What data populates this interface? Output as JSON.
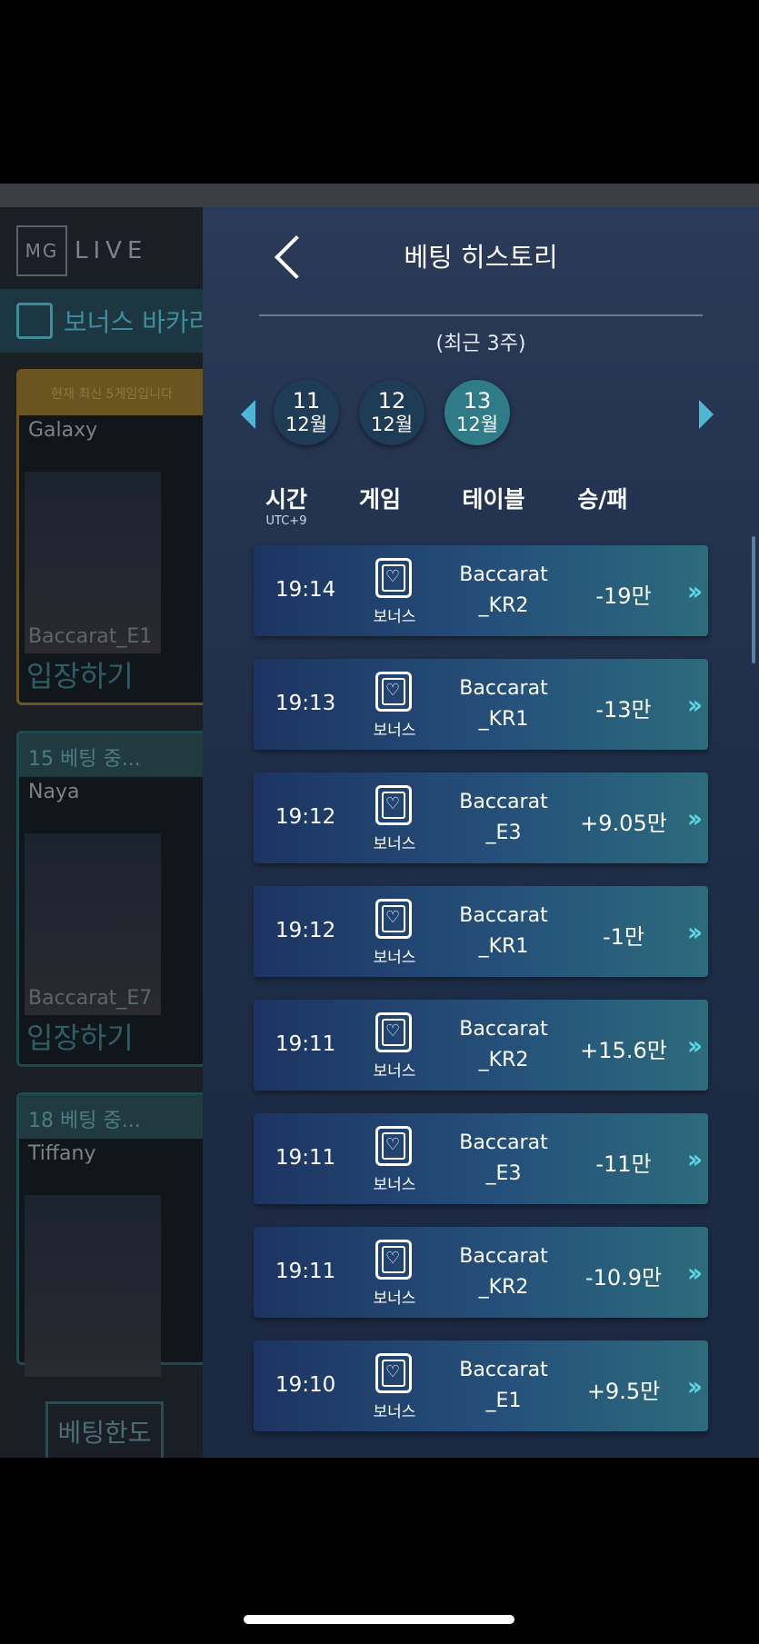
{
  "lobby": {
    "logo_left": "MG",
    "logo_right": "LIVE",
    "tab_label": "보너스 바카라",
    "cards": [
      {
        "banner": "현재 최신 5게임입니다",
        "dealer": "Galaxy",
        "table": "Baccarat_E1",
        "enter": "입장하기"
      },
      {
        "banner": "15  베팅 중...",
        "dealer": "Naya",
        "table": "Baccarat_E7",
        "enter": "입장하기"
      },
      {
        "banner": "18  베팅 중...",
        "dealer": "Tiffany",
        "table": "",
        "enter": ""
      }
    ],
    "bet_limit": "베팅한도"
  },
  "panel": {
    "title": "베팅 히스토리",
    "subtitle": "(최근 3주)",
    "dates": [
      {
        "day": "11",
        "month": "12월",
        "active": false
      },
      {
        "day": "12",
        "month": "12월",
        "active": false
      },
      {
        "day": "13",
        "month": "12월",
        "active": true
      }
    ],
    "headers": {
      "time": "시간",
      "time_tz": "UTC+9",
      "game": "게임",
      "table": "테이블",
      "result": "승/패"
    },
    "rows": [
      {
        "time": "19:14",
        "game": "보너스",
        "table_1": "Baccarat",
        "table_2": "_KR2",
        "result": "-19만"
      },
      {
        "time": "19:13",
        "game": "보너스",
        "table_1": "Baccarat",
        "table_2": "_KR1",
        "result": "-13만"
      },
      {
        "time": "19:12",
        "game": "보너스",
        "table_1": "Baccarat",
        "table_2": "_E3",
        "result": "+9.05만"
      },
      {
        "time": "19:12",
        "game": "보너스",
        "table_1": "Baccarat",
        "table_2": "_KR1",
        "result": "-1만"
      },
      {
        "time": "19:11",
        "game": "보너스",
        "table_1": "Baccarat",
        "table_2": "_KR2",
        "result": "+15.6만"
      },
      {
        "time": "19:11",
        "game": "보너스",
        "table_1": "Baccarat",
        "table_2": "_E3",
        "result": "-11만"
      },
      {
        "time": "19:11",
        "game": "보너스",
        "table_1": "Baccarat",
        "table_2": "_KR2",
        "result": "-10.9만"
      },
      {
        "time": "19:10",
        "game": "보너스",
        "table_1": "Baccarat",
        "table_2": "_E1",
        "result": "+9.5만"
      }
    ]
  }
}
